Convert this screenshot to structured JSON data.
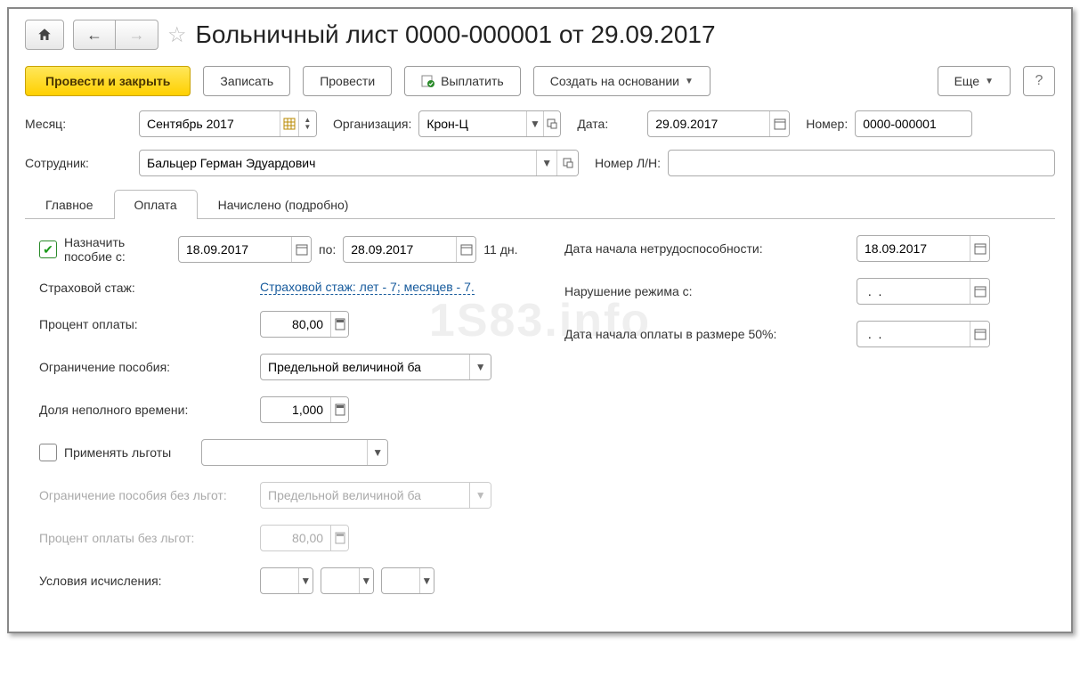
{
  "header": {
    "title": "Больничный лист 0000-000001 от 29.09.2017"
  },
  "toolbar": {
    "post_close": "Провести и закрыть",
    "save": "Записать",
    "post": "Провести",
    "pay": "Выплатить",
    "create_based": "Создать на основании",
    "more": "Еще",
    "help": "?"
  },
  "form": {
    "month_label": "Месяц:",
    "month_value": "Сентябрь 2017",
    "org_label": "Организация:",
    "org_value": "Крон-Ц",
    "date_label": "Дата:",
    "date_value": "29.09.2017",
    "number_label": "Номер:",
    "number_value": "0000-000001",
    "employee_label": "Сотрудник:",
    "employee_value": "Бальцер Герман Эдуардович",
    "ln_label": "Номер Л/Н:",
    "ln_value": ""
  },
  "tabs": {
    "main": "Главное",
    "payment": "Оплата",
    "accrued": "Начислено (подробно)"
  },
  "payment": {
    "assign_label": "Назначить пособие с:",
    "date_from": "18.09.2017",
    "to_label": "по:",
    "date_to": "28.09.2017",
    "days": "11 дн.",
    "stazh_label": "Страховой стаж:",
    "stazh_link": "Страховой стаж: лет - 7;  месяцев - 7.",
    "percent_label": "Процент оплаты:",
    "percent_value": "80,00",
    "limit_label": "Ограничение пособия:",
    "limit_value": "Предельной величиной ба",
    "part_time_label": "Доля неполного времени:",
    "part_time_value": "1,000",
    "apply_benefits_label": "Применять льготы",
    "limit_nobenefit_label": "Ограничение пособия без льгот:",
    "limit_nobenefit_value": "Предельной величиной ба",
    "percent_nobenefit_label": "Процент оплаты без льгот:",
    "percent_nobenefit_value": "80,00",
    "conditions_label": "Условия исчисления:",
    "disability_start_label": "Дата начала нетрудоспособности:",
    "disability_start_value": "18.09.2017",
    "violation_label": "Нарушение режима с:",
    "violation_value": " .  .    ",
    "half_pay_label": "Дата начала оплаты в размере 50%:",
    "half_pay_value": " .  .    "
  },
  "watermark": "1S83.info"
}
